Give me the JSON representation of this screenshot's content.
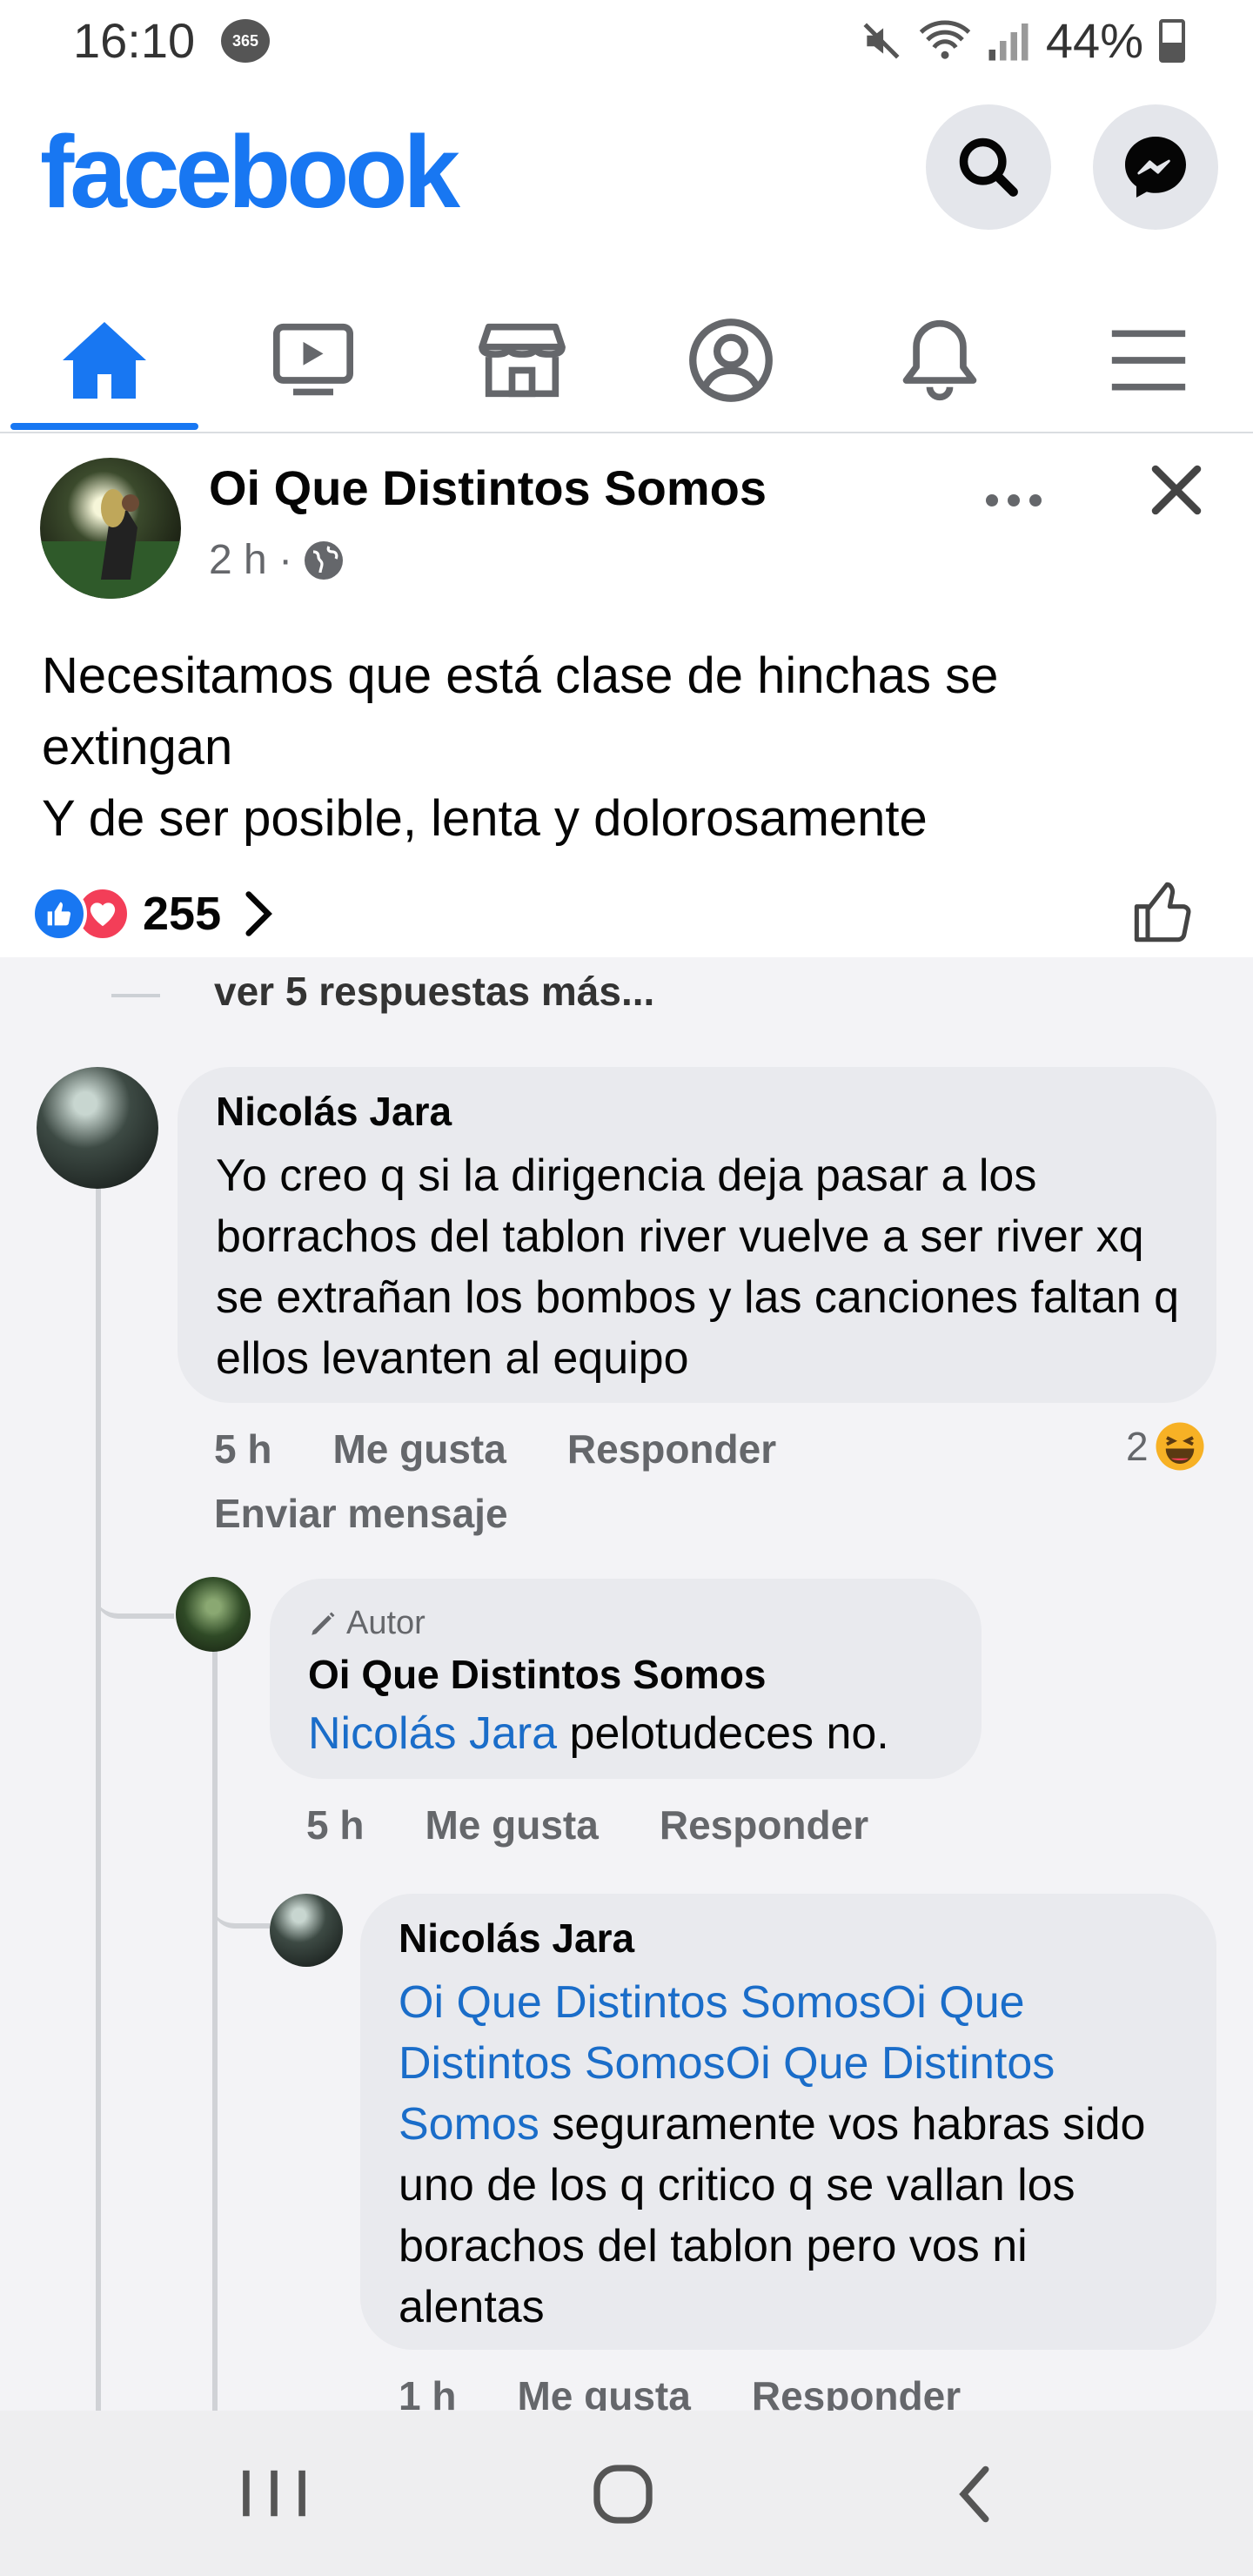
{
  "status": {
    "time": "16:10",
    "badge": "365",
    "battery": "44%"
  },
  "header": {
    "logo": "facebook"
  },
  "nav": {
    "items": [
      {
        "icon": "home-icon"
      },
      {
        "icon": "watch-icon"
      },
      {
        "icon": "marketplace-icon"
      },
      {
        "icon": "profile-icon"
      },
      {
        "icon": "notifications-icon"
      },
      {
        "icon": "menu-icon"
      }
    ],
    "active_index": 0
  },
  "post": {
    "author": "Oi Que Distintos Somos",
    "time": "2 h ·",
    "text_line1": "Necesitamos que está clase de hinchas se",
    "text_line2": "extingan",
    "text_line3": "Y de ser posible, lenta y dolorosamente",
    "reaction_count": "255"
  },
  "comments": {
    "more_replies": "ver 5 respuestas más...",
    "c1": {
      "author": "Nicolás Jara",
      "text": "Yo creo q si la dirigencia deja pasar a los borrachos del tablon river vuelve a ser river xq se extrañan los bombos y las canciones faltan q ellos levanten al equipo",
      "time": "5 h",
      "like": "Me gusta",
      "reply": "Responder",
      "send": "Enviar mensaje",
      "reaction_count": "2"
    },
    "c2": {
      "tag": "Autor",
      "author": "Oi Que Distintos Somos",
      "mention": "Nicolás Jara",
      "text": " pelotudeces no.",
      "time": "5 h",
      "like": "Me gusta",
      "reply": "Responder"
    },
    "c3": {
      "author": "Nicolás Jara",
      "mention": "Oi Que Distintos SomosOi Que Distintos SomosOi Que Distintos Somos",
      "text": " seguramente vos habras sido uno de los q critico q se vallan los borachos del tablon pero vos ni alentas",
      "time": "1 h",
      "like": "Me gusta",
      "reply": "Responder"
    }
  },
  "colors": {
    "brand": "#1877f2",
    "mention": "#1a6dc9",
    "like": "#1877f2",
    "love": "#f33e58"
  }
}
